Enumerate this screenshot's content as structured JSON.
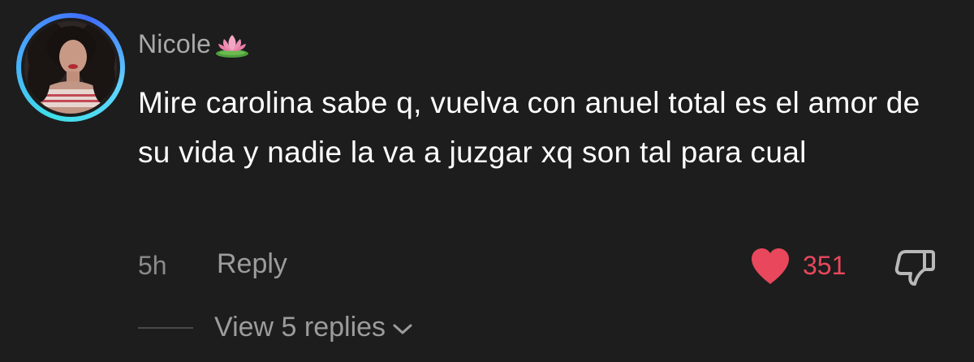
{
  "comment": {
    "username": "Nicole",
    "username_emoji": "lotus-icon",
    "text": "Mire carolina sabe q, vuelva con anuel total es el amor de su vida y nadie la va a juzgar xq son tal para cual",
    "time": "5h",
    "reply_label": "Reply",
    "likes": "351",
    "view_replies_label": "View 5 replies"
  },
  "colors": {
    "background": "#1d1d1d",
    "like_accent": "#e8475c",
    "avatar_ring": "#4aa8ff"
  },
  "icons": {
    "like": "heart-icon",
    "dislike": "thumbs-down-icon",
    "expand": "chevron-down-icon"
  }
}
